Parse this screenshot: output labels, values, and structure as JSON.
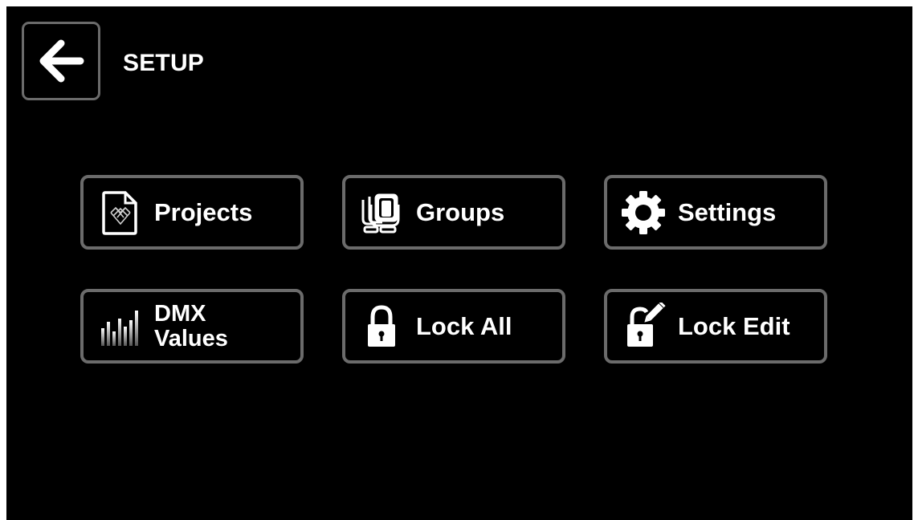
{
  "header": {
    "title": "SETUP",
    "back_icon": "back-arrow-icon"
  },
  "tiles": [
    {
      "label": "Projects",
      "icon": "project-file-icon"
    },
    {
      "label": "Groups",
      "icon": "groups-icon"
    },
    {
      "label": "Settings",
      "icon": "gear-icon"
    },
    {
      "label_line1": "DMX",
      "label_line2": "Values",
      "icon": "dmx-levels-icon"
    },
    {
      "label": "Lock All",
      "icon": "lock-icon"
    },
    {
      "label": "Lock Edit",
      "icon": "lock-edit-icon"
    }
  ],
  "colors": {
    "background": "#000000",
    "border": "#6b6b6b",
    "text": "#ffffff"
  }
}
